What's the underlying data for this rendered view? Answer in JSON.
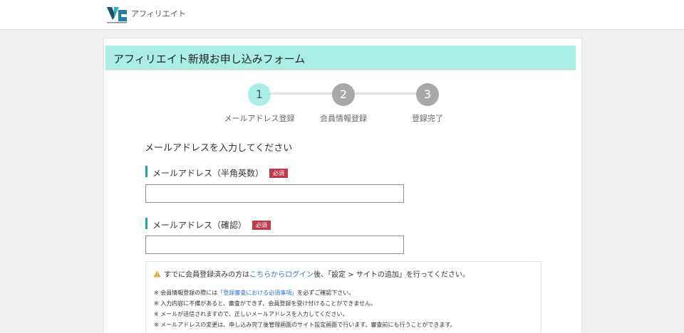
{
  "header": {
    "logo_text": "アフィリエイト",
    "logo_icon": "vc-logo-icon"
  },
  "form": {
    "title": "アフィリエイト新規お申し込みフォーム",
    "steps": [
      {
        "number": "1",
        "label": "メールアドレス登録",
        "active": true
      },
      {
        "number": "2",
        "label": "会員情報登録",
        "active": false
      },
      {
        "number": "3",
        "label": "登録完了",
        "active": false
      }
    ],
    "section_heading": "メールアドレスを入力してください",
    "fields": [
      {
        "label": "メールアドレス（半角英数）",
        "badge": "必須",
        "value": "",
        "placeholder": ""
      },
      {
        "label": "メールアドレス（確認）",
        "badge": "必須",
        "value": "",
        "placeholder": ""
      }
    ]
  },
  "notice": {
    "icon": "warning-icon",
    "main_prefix": "すでに会員登録済みの方は",
    "main_link": "こちらからログイン",
    "main_suffix": "後、「設定 > サイトの追加」を行ってください。",
    "note1_prefix": "※ 会員情報登録の際には",
    "note1_link": "「登録審査における必須事項」",
    "note1_suffix": "を必ずご確認下さい。",
    "note2": "※ 入力内容に不備があると、審査ができず、会員登録を受け付けることができません。",
    "note3": "※ メールが送信されますので、正しいメールアドレスを入力してください。",
    "note4": "※ メールアドレスの変更は、申し込み完了後管理画面のサイト設定画面で行います。審査前にも行うことができます。"
  },
  "colors": {
    "accent": "#a9efe6",
    "label_bar": "#1ea7a0",
    "required": "#c0394b",
    "link": "#2f73c9",
    "inactive_step": "#a8a8a8"
  }
}
